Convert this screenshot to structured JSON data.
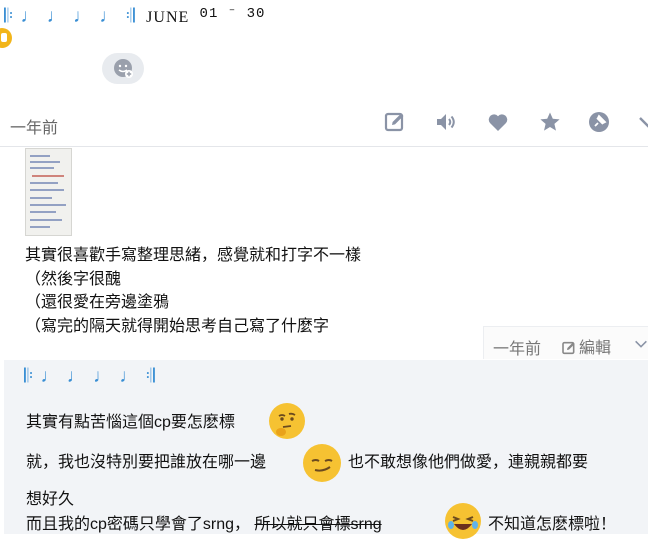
{
  "header": {
    "author": "𝄆 ♩ ♩ ♩ ♩ 𝄇",
    "month": "JUNE",
    "dates": "01 ⁻ 30",
    "lock_icon": "lock-icon",
    "add_emoji_icon": "add-emoji-icon"
  },
  "post": {
    "time": "一年前",
    "toolbar": [
      "edit-icon",
      "speaker-icon",
      "heart-icon",
      "star-icon",
      "pin-icon",
      "chevron-down-icon"
    ],
    "lines": [
      "其實很喜歡手寫整理思緒，感覺就和打字不一樣",
      "（然後字很醜",
      "（還很愛在旁邊塗鴉",
      "（寫完的隔天就得開始思考自己寫了什麼字"
    ]
  },
  "meta": {
    "time": "一年前",
    "edit_label": "編輯"
  },
  "comment": {
    "author": "𝄆 ♩ ♩ ♩ ♩ 𝄇",
    "line1": "其實有點苦惱這個cp要怎麽標",
    "line2a": "就，我也沒特別要把誰放在哪一邊",
    "line2b": "也不敢想像他們做愛，連親親都要",
    "line3": "想好久",
    "line4a": "而且我的cp密碼只學會了srng，",
    "line4b": "所以就只會標srng",
    "line4c": "不知道怎麽標啦！"
  },
  "colors": {
    "accent": "#3a8fd4",
    "icon_gray": "#8a93a6",
    "comment_bg": "#f2f4f7",
    "lock": "#f2b51a"
  }
}
